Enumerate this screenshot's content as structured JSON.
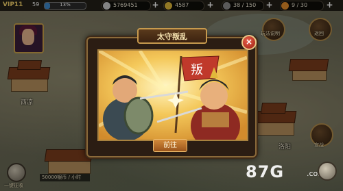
{
  "topbar": {
    "vip": "VIP11",
    "level": "59",
    "xp_percent_text": "13%",
    "xp_fraction": 0.13,
    "silver": "5769451",
    "gold": "4587",
    "stamina": "38 / 150",
    "food": "9 / 30",
    "plus": "+"
  },
  "cities": {
    "xiliang": "西凉",
    "luoyang": "洛阳"
  },
  "right_buttons": {
    "rules": "玩法说明",
    "back": "返回",
    "war": "宣战"
  },
  "left_bottom": {
    "collect": "一键征收",
    "info": "50000银币 / 小时"
  },
  "modal": {
    "title": "太守叛乱",
    "close": "×",
    "go_button": "前往",
    "banner_char": "叛"
  },
  "watermark": {
    "brand": "87G",
    "suffix": ".com"
  },
  "colors": {
    "accent_gold": "#c79a4e",
    "close_red": "#c0392b",
    "button_orange": "#d28a3a"
  }
}
